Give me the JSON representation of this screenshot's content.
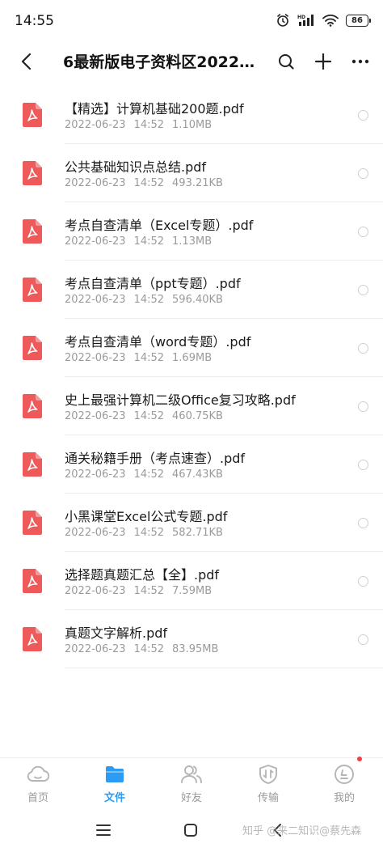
{
  "status_bar": {
    "time": "14:55",
    "battery": "86",
    "icons": [
      "alarm-icon",
      "hd-signal-icon",
      "wifi-icon",
      "battery-icon"
    ]
  },
  "header": {
    "title": "6最新版电子资料区2022年…",
    "icons": [
      "back-icon",
      "search-icon",
      "plus-icon",
      "more-icon"
    ]
  },
  "files": [
    {
      "name": "【精选】计算机基础200题.pdf",
      "date": "2022-06-23",
      "time": "14:52",
      "size": "1.10MB"
    },
    {
      "name": "公共基础知识点总结.pdf",
      "date": "2022-06-23",
      "time": "14:52",
      "size": "493.21KB"
    },
    {
      "name": "考点自查清单（Excel专题）.pdf",
      "date": "2022-06-23",
      "time": "14:52",
      "size": "1.13MB"
    },
    {
      "name": "考点自查清单（ppt专题）.pdf",
      "date": "2022-06-23",
      "time": "14:52",
      "size": "596.40KB"
    },
    {
      "name": "考点自查清单（word专题）.pdf",
      "date": "2022-06-23",
      "time": "14:52",
      "size": "1.69MB"
    },
    {
      "name": "史上最强计算机二级Office复习攻略.pdf",
      "date": "2022-06-23",
      "time": "14:52",
      "size": "460.75KB"
    },
    {
      "name": "通关秘籍手册（考点速查）.pdf",
      "date": "2022-06-23",
      "time": "14:52",
      "size": "467.43KB"
    },
    {
      "name": "小黑课堂Excel公式专题.pdf",
      "date": "2022-06-23",
      "time": "14:52",
      "size": "582.71KB"
    },
    {
      "name": "选择题真题汇总【全】.pdf",
      "date": "2022-06-23",
      "time": "14:52",
      "size": "7.59MB"
    },
    {
      "name": "真题文字解析.pdf",
      "date": "2022-06-23",
      "time": "14:52",
      "size": "83.95MB"
    }
  ],
  "tabs": [
    {
      "label": "首页",
      "icon": "cloud-home-icon",
      "active": false
    },
    {
      "label": "文件",
      "icon": "folder-icon",
      "active": true
    },
    {
      "label": "好友",
      "icon": "friends-icon",
      "active": false
    },
    {
      "label": "传输",
      "icon": "transfer-icon",
      "active": false
    },
    {
      "label": "我的",
      "icon": "profile-icon",
      "active": false
    }
  ],
  "nav": {
    "icons": [
      "menu-icon",
      "home-square-icon",
      "back-chevron-icon"
    ],
    "watermark": "知乎 @来二知识@蔡先森"
  },
  "colors": {
    "accent": "#2b9bf4",
    "pdf_red": "#ee5a5a",
    "badge_red": "#f04040",
    "meta_gray": "#9a9a9a"
  }
}
